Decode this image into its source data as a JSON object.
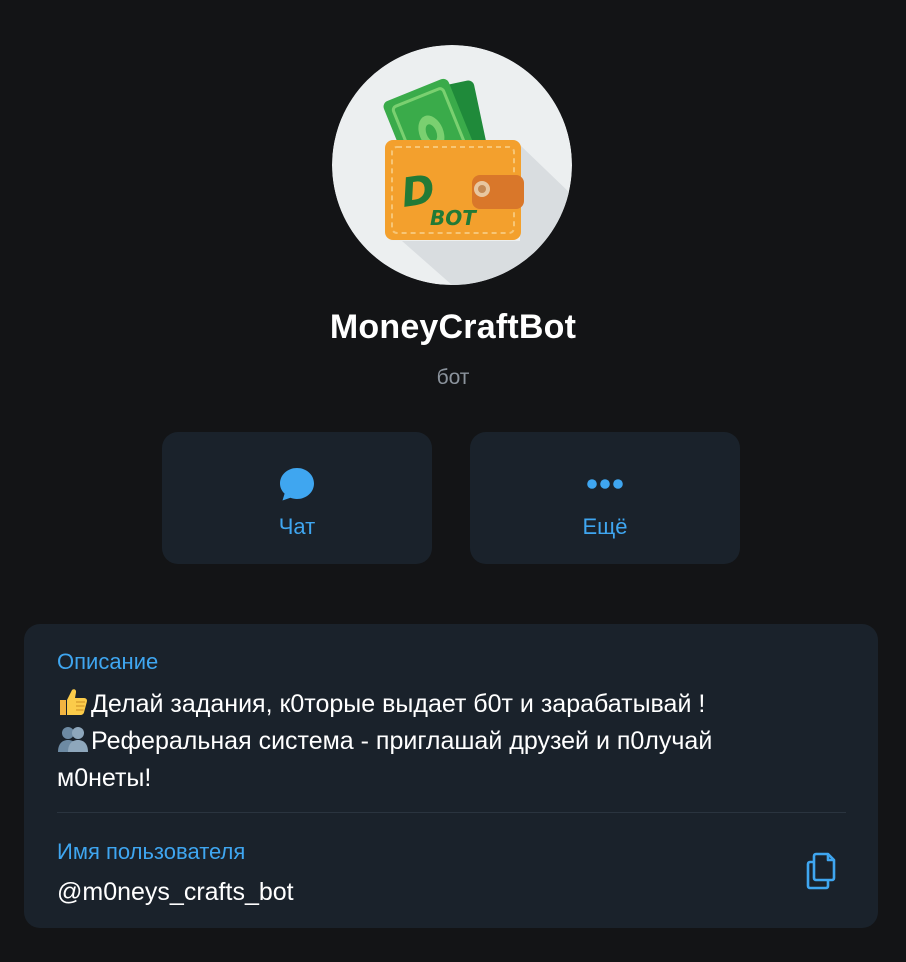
{
  "profile": {
    "name": "MoneyCraftBot",
    "subtitle": "бот",
    "avatar_icon": "wallet-money-icon",
    "avatar_text": "DBOT"
  },
  "actions": {
    "chat": {
      "label": "Чат",
      "icon": "chat-bubble-icon"
    },
    "more": {
      "label": "Ещё",
      "icon": "more-dots-icon"
    }
  },
  "description": {
    "label": "Описание",
    "line1_emoji": "thumbs-up-emoji",
    "line1": "Делай задания, к0торые выдает б0т и зарабатывай !",
    "line2_emoji": "busts-in-silhouette-emoji",
    "line2": "Реферальная система - приглашай друзей и п0лучай",
    "line3": "м0неты!"
  },
  "username": {
    "label": "Имя пользователя",
    "value": "@m0neys_crafts_bot",
    "copy_icon": "copy-icon"
  },
  "colors": {
    "background": "#131416",
    "card": "#1a222b",
    "accent": "#3fa6f0",
    "secondary_text": "#8b939c"
  }
}
